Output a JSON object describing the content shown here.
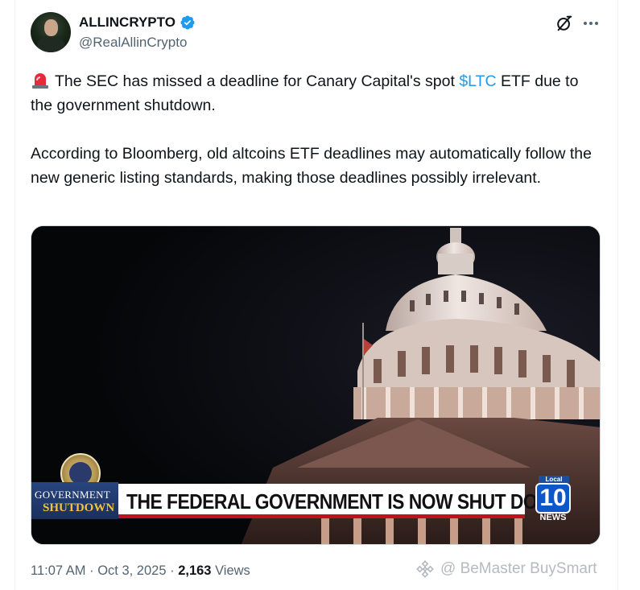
{
  "author": {
    "display_name": "ALLINCRYPTO",
    "handle": "@RealAllinCrypto",
    "verified": true
  },
  "tweet": {
    "emoji": "siren-icon",
    "line1_before": "The SEC has missed a deadline for Canary Capital's spot ",
    "cashtag": "$LTC",
    "line1_after": " ETF due to the government shutdown.",
    "paragraph2": "According to Bloomberg, old altcoins ETF deadlines may automatically follow the new generic listing standards, making those deadlines possibly irrelevant."
  },
  "media": {
    "headline": "THE FEDERAL GOVERNMENT IS NOW SHUT DOWN",
    "badge_line1": "GOVERNMENT",
    "badge_line2": "SHUTDOWN",
    "news_local": "Local",
    "news_number": "10",
    "news_word": "NEWS"
  },
  "meta": {
    "time": "11:07 AM",
    "date": "Oct 3, 2025",
    "views_count": "2,163",
    "views_label": "Views",
    "separator": "·"
  },
  "watermark": {
    "text": "@ BeMaster BuySmart"
  },
  "colors": {
    "accent": "#1d9bf0",
    "text": "#0f1419",
    "muted": "#536471",
    "lower_third_red": "#c0121b"
  }
}
